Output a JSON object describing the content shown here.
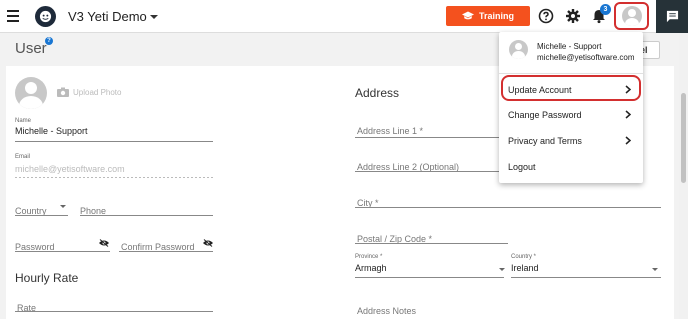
{
  "topbar": {
    "app_name": "V3 Yeti Demo",
    "training_label": "Training",
    "notification_count": "3"
  },
  "page": {
    "title": "User",
    "help_badge": "?",
    "cancel_label": "Cancel"
  },
  "profile": {
    "upload_photo_label": "Upload Photo",
    "name_label": "Name",
    "name_value": "Michelle - Support",
    "email_label": "Email",
    "email_value": "michelle@yetisoftware.com",
    "country_placeholder": "Country",
    "phone_placeholder": "Phone",
    "password_placeholder": "Password",
    "confirm_password_placeholder": "Confirm Password"
  },
  "hourly_rate": {
    "title": "Hourly Rate",
    "rate_placeholder": "Rate"
  },
  "address": {
    "title": "Address",
    "line1_placeholder": "Address Line 1 *",
    "line2_placeholder": "Address Line 2 (Optional)",
    "city_placeholder": "City *",
    "postal_placeholder": "Postal / Zip Code *",
    "province_label": "Province *",
    "province_value": "Armagh",
    "country_label": "Country *",
    "country_value": "Ireland",
    "notes_placeholder": "Address Notes"
  },
  "account_menu": {
    "user_name": "Michelle - Support",
    "user_email": "michelle@yetisoftware.com",
    "items": [
      {
        "label": "Update Account"
      },
      {
        "label": "Change Password"
      },
      {
        "label": "Privacy and Terms"
      },
      {
        "label": "Logout"
      }
    ]
  },
  "colors": {
    "training_button": "#f4511e",
    "highlight": "#d32f2f",
    "badge": "#1976d2",
    "chat_panel": "#263238"
  }
}
